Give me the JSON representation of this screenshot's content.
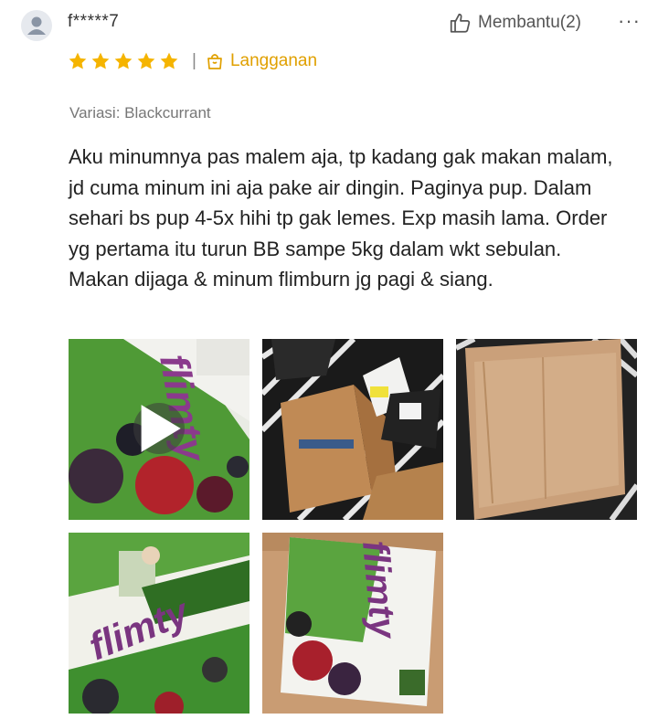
{
  "review": {
    "username": "f*****7",
    "helpful_label": "Membantu(2)",
    "more_label": "···",
    "rating": 5,
    "rating_max": 5,
    "badge_label": "Langganan",
    "variant": "Variasi: Blackcurrant",
    "text": "Aku minumnya pas malem aja, tp kadang gak makan malam, jd cuma minum ini aja pake air dingin. Paginya pup. Dalam sehari bs pup 4-5x hihi tp gak lemes. Exp masih lama. Order yg pertama itu turun BB sampe 5kg dalam wkt sebulan. Makan dijaga & minum flimburn jg pagi & siang."
  },
  "media": {
    "photos": [
      {
        "type": "video",
        "brand_text": "flimty"
      },
      {
        "type": "image"
      },
      {
        "type": "image"
      },
      {
        "type": "image",
        "brand_text": "flimty"
      },
      {
        "type": "image",
        "brand_text": "flimty"
      }
    ]
  },
  "colors": {
    "star": "#f5b400",
    "badge": "#e0a000",
    "avatar_bg": "#e6e9ee",
    "avatar_fg": "#8a95a5"
  },
  "icons": {
    "avatar": "user-icon",
    "helpful": "thumbs-up-icon",
    "more": "ellipsis-icon",
    "badge": "shopping-bag-icon",
    "play": "play-icon"
  }
}
